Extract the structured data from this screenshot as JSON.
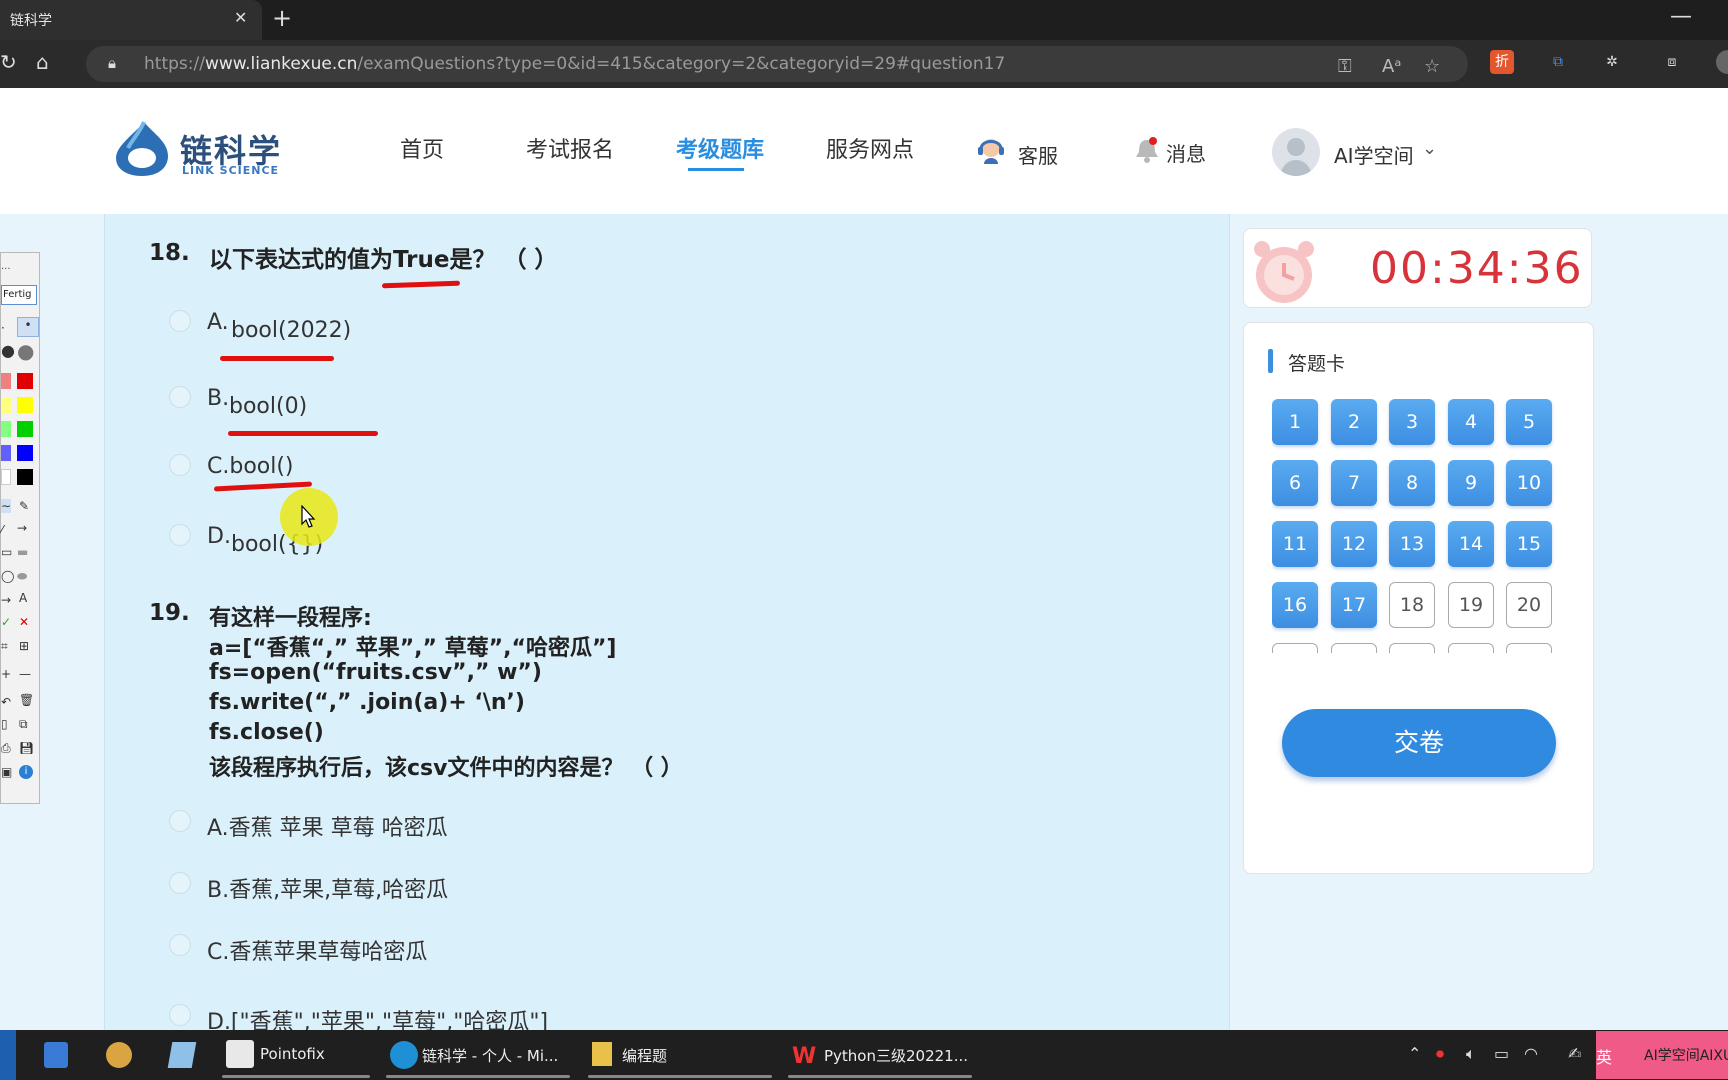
{
  "browser": {
    "tab_title": "链科学",
    "url_prefix": "https://",
    "url_host": "www.liankexue.cn",
    "url_path": "/examQuestions?type=0&id=415&category=2&categoryid=29#question17"
  },
  "site": {
    "logo_cn": "链科学",
    "logo_en": "LINK SCIENCE",
    "nav": [
      "首页",
      "考试报名",
      "考级题库",
      "服务网点"
    ],
    "active_nav": "考级题库",
    "service_label": "客服",
    "message_label": "消息",
    "user_label": "AI学空间"
  },
  "questions": {
    "q18": {
      "number": "18.",
      "text": "以下表达式的值为True是？ （   ）",
      "options": [
        "A.",
        "bool(2022)",
        "B.",
        "bool(0)",
        "C.bool()",
        "D.",
        "bool({})"
      ]
    },
    "q19": {
      "number": "19.",
      "lines": [
        "有这样一段程序:",
        "a=[“香蕉“,” 苹果”,” 草莓”,“哈密瓜”]",
        "fs=open(“fruits.csv”,” w”)",
        "fs.write(“,” .join(a)+ ‘\\n’)",
        "fs.close()",
        "该段程序执行后，该csv文件中的内容是？ （   ）"
      ],
      "options": [
        "A.香蕉 苹果 草莓 哈密瓜",
        "B.香蕉,苹果,草莓,哈密瓜",
        "C.香蕉苹果草莓哈密瓜",
        "D.[\"香蕉\",\"苹果\",\"草莓\",\"哈密瓜\"]"
      ]
    }
  },
  "pointofix": {
    "title": "...",
    "done_label": "Fertig",
    "text_tool": "A"
  },
  "timer": "00:34:36",
  "answer_card": {
    "title": "答题卡",
    "answered": [
      "1",
      "2",
      "3",
      "4",
      "5",
      "6",
      "7",
      "8",
      "9",
      "10",
      "11",
      "12",
      "13",
      "14",
      "15",
      "16",
      "17"
    ],
    "unanswered": [
      "18",
      "19",
      "20"
    ],
    "submit_label": "交卷"
  },
  "taskbar": {
    "apps": [
      "Pointofix",
      "链科学 - 个人 - Mi...",
      "编程题",
      "Python三级20221..."
    ],
    "ime": "英",
    "promo": "AI学空间AIXUE"
  },
  "colors": {
    "accent": "#2a8ee0",
    "timer": "#d8333b",
    "panel": "#daf1fb",
    "annotation": "#e01010"
  }
}
